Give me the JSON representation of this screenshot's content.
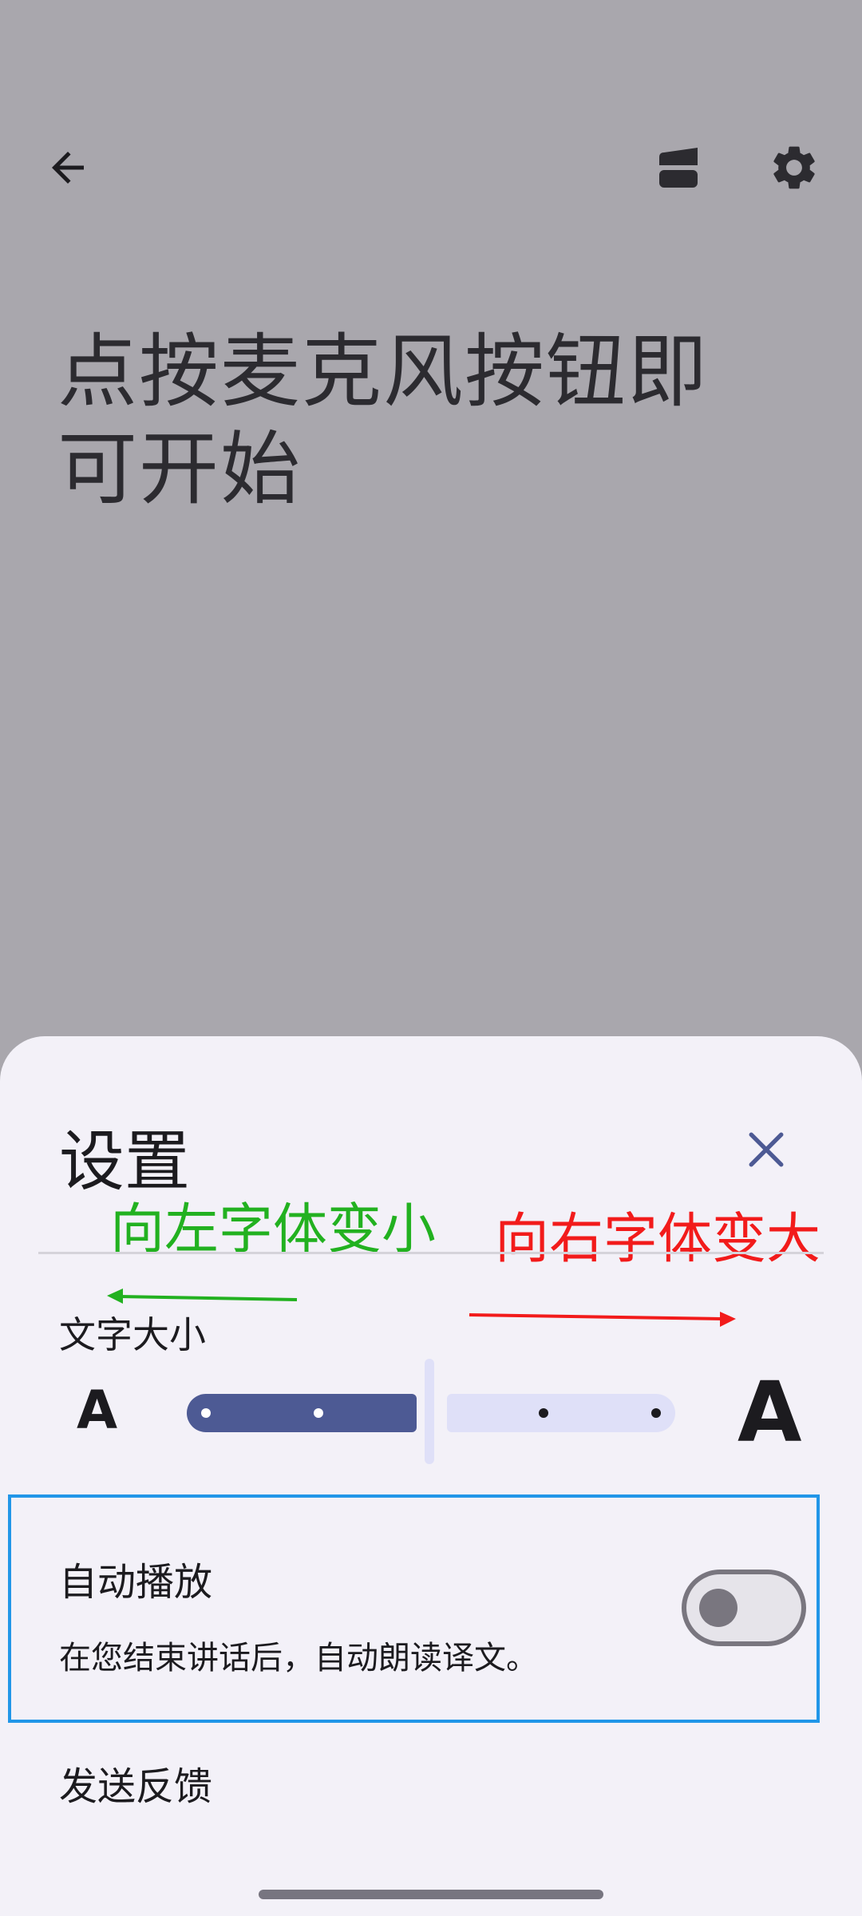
{
  "header": {
    "back_icon": "arrow-back-icon",
    "layout_icon": "split-view-icon",
    "settings_icon": "gear-icon"
  },
  "main": {
    "prompt": "点按麦克风按钮即可开始"
  },
  "sheet": {
    "title": "设置",
    "close_icon": "close-icon",
    "annotation_left": "向左字体变小",
    "annotation_right": "向右字体变大",
    "font_size": {
      "label": "文字大小",
      "small_a": "A",
      "large_a": "A",
      "slider_value_fraction": 0.5
    },
    "autoplay": {
      "title": "自动播放",
      "description": "在您结束讲话后，自动朗读译文。",
      "enabled": false
    },
    "feedback_label": "发送反馈"
  },
  "colors": {
    "accent": "#4d5a94",
    "annotation_green": "#22b120",
    "annotation_red": "#f21b1b",
    "highlight_border": "#2196e8"
  }
}
